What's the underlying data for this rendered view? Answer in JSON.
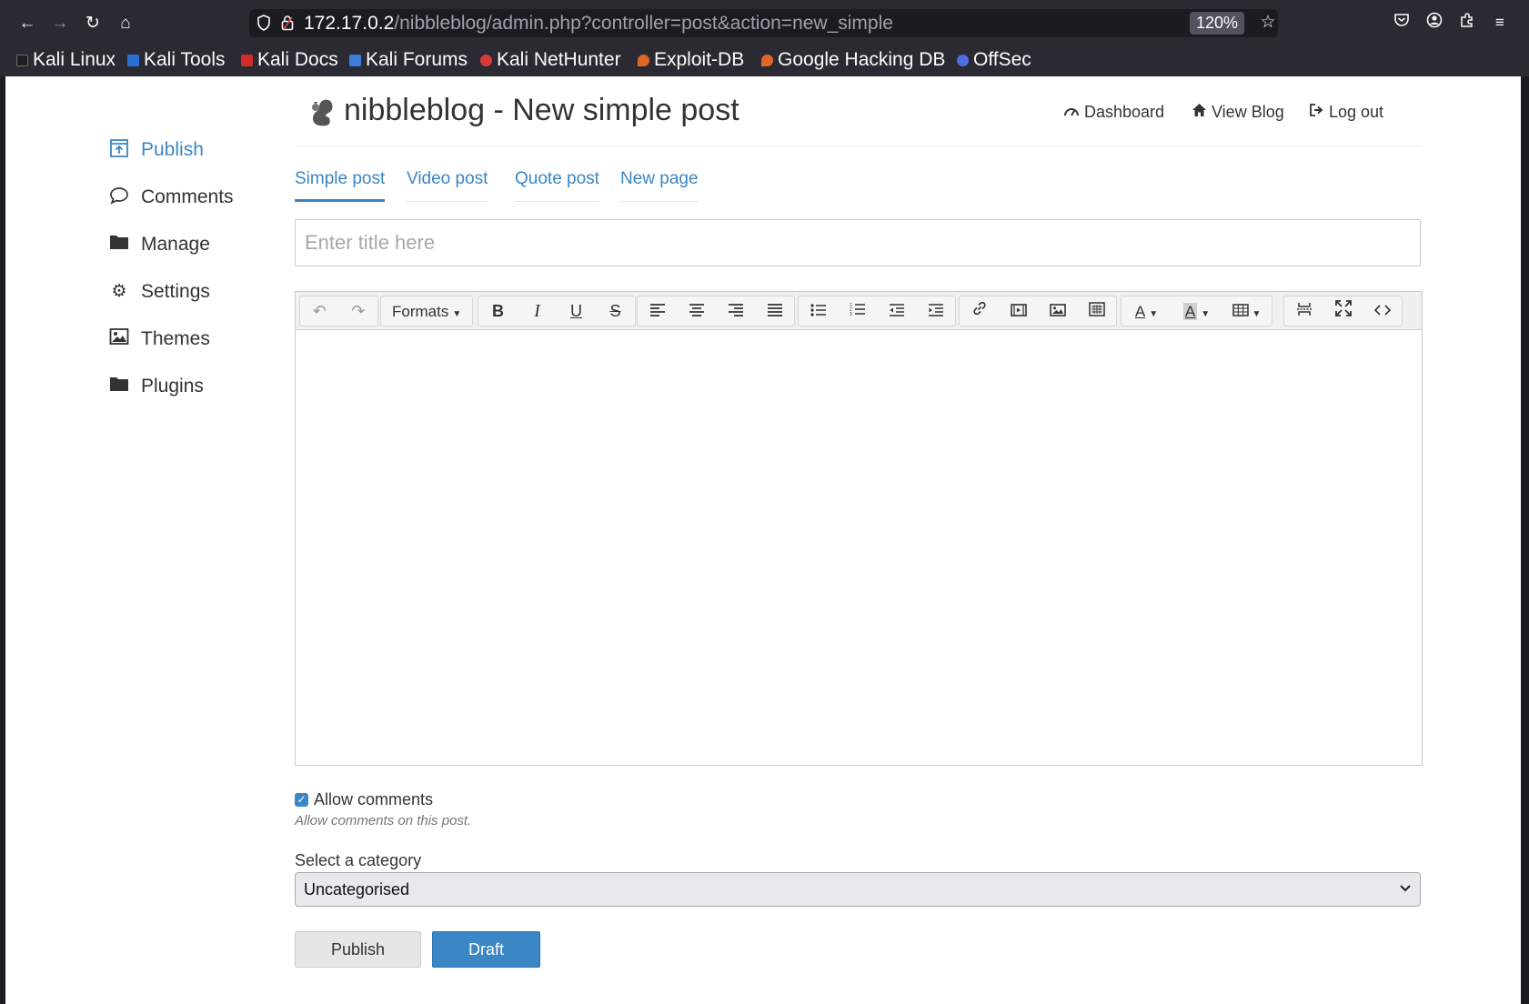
{
  "browser": {
    "url_host": "172.17.0.2",
    "url_path": "/nibbleblog/admin.php?controller=post&action=new_simple",
    "zoom": "120%",
    "bookmarks": [
      {
        "label": "Kali Linux",
        "color": "#1e1e1e"
      },
      {
        "label": "Kali Tools",
        "color": "#2a6fd6"
      },
      {
        "label": "Kali Docs",
        "color": "#d32a2a"
      },
      {
        "label": "Kali Forums",
        "color": "#3c7ee0"
      },
      {
        "label": "Kali NetHunter",
        "color": "#d83a3a"
      },
      {
        "label": "Exploit-DB",
        "color": "#e0662a"
      },
      {
        "label": "Google Hacking DB",
        "color": "#e0662a"
      },
      {
        "label": "OffSec",
        "color": "#4a6fe0"
      }
    ]
  },
  "sidebar": {
    "items": [
      {
        "label": "Publish",
        "icon": "publish-icon"
      },
      {
        "label": "Comments",
        "icon": "comment-icon"
      },
      {
        "label": "Manage",
        "icon": "folder-icon"
      },
      {
        "label": "Settings",
        "icon": "gear-icon"
      },
      {
        "label": "Themes",
        "icon": "image-icon"
      },
      {
        "label": "Plugins",
        "icon": "folder-icon"
      }
    ]
  },
  "header": {
    "title": "nibbleblog - New simple post",
    "links": {
      "dashboard": "Dashboard",
      "view_blog": "View Blog",
      "logout": "Log out"
    }
  },
  "tabs": [
    {
      "label": "Simple post",
      "active": true
    },
    {
      "label": "Video post",
      "active": false
    },
    {
      "label": "Quote post",
      "active": false
    },
    {
      "label": "New page",
      "active": false
    }
  ],
  "form": {
    "title_placeholder": "Enter title here",
    "formats_label": "Formats",
    "allow_comments_label": "Allow comments",
    "allow_comments_checked": true,
    "allow_comments_help": "Allow comments on this post.",
    "category_label": "Select a category",
    "category_selected": "Uncategorised",
    "publish_label": "Publish",
    "draft_label": "Draft"
  },
  "colors": {
    "accent": "#3b86c4",
    "chrome": "#2b2a33"
  }
}
